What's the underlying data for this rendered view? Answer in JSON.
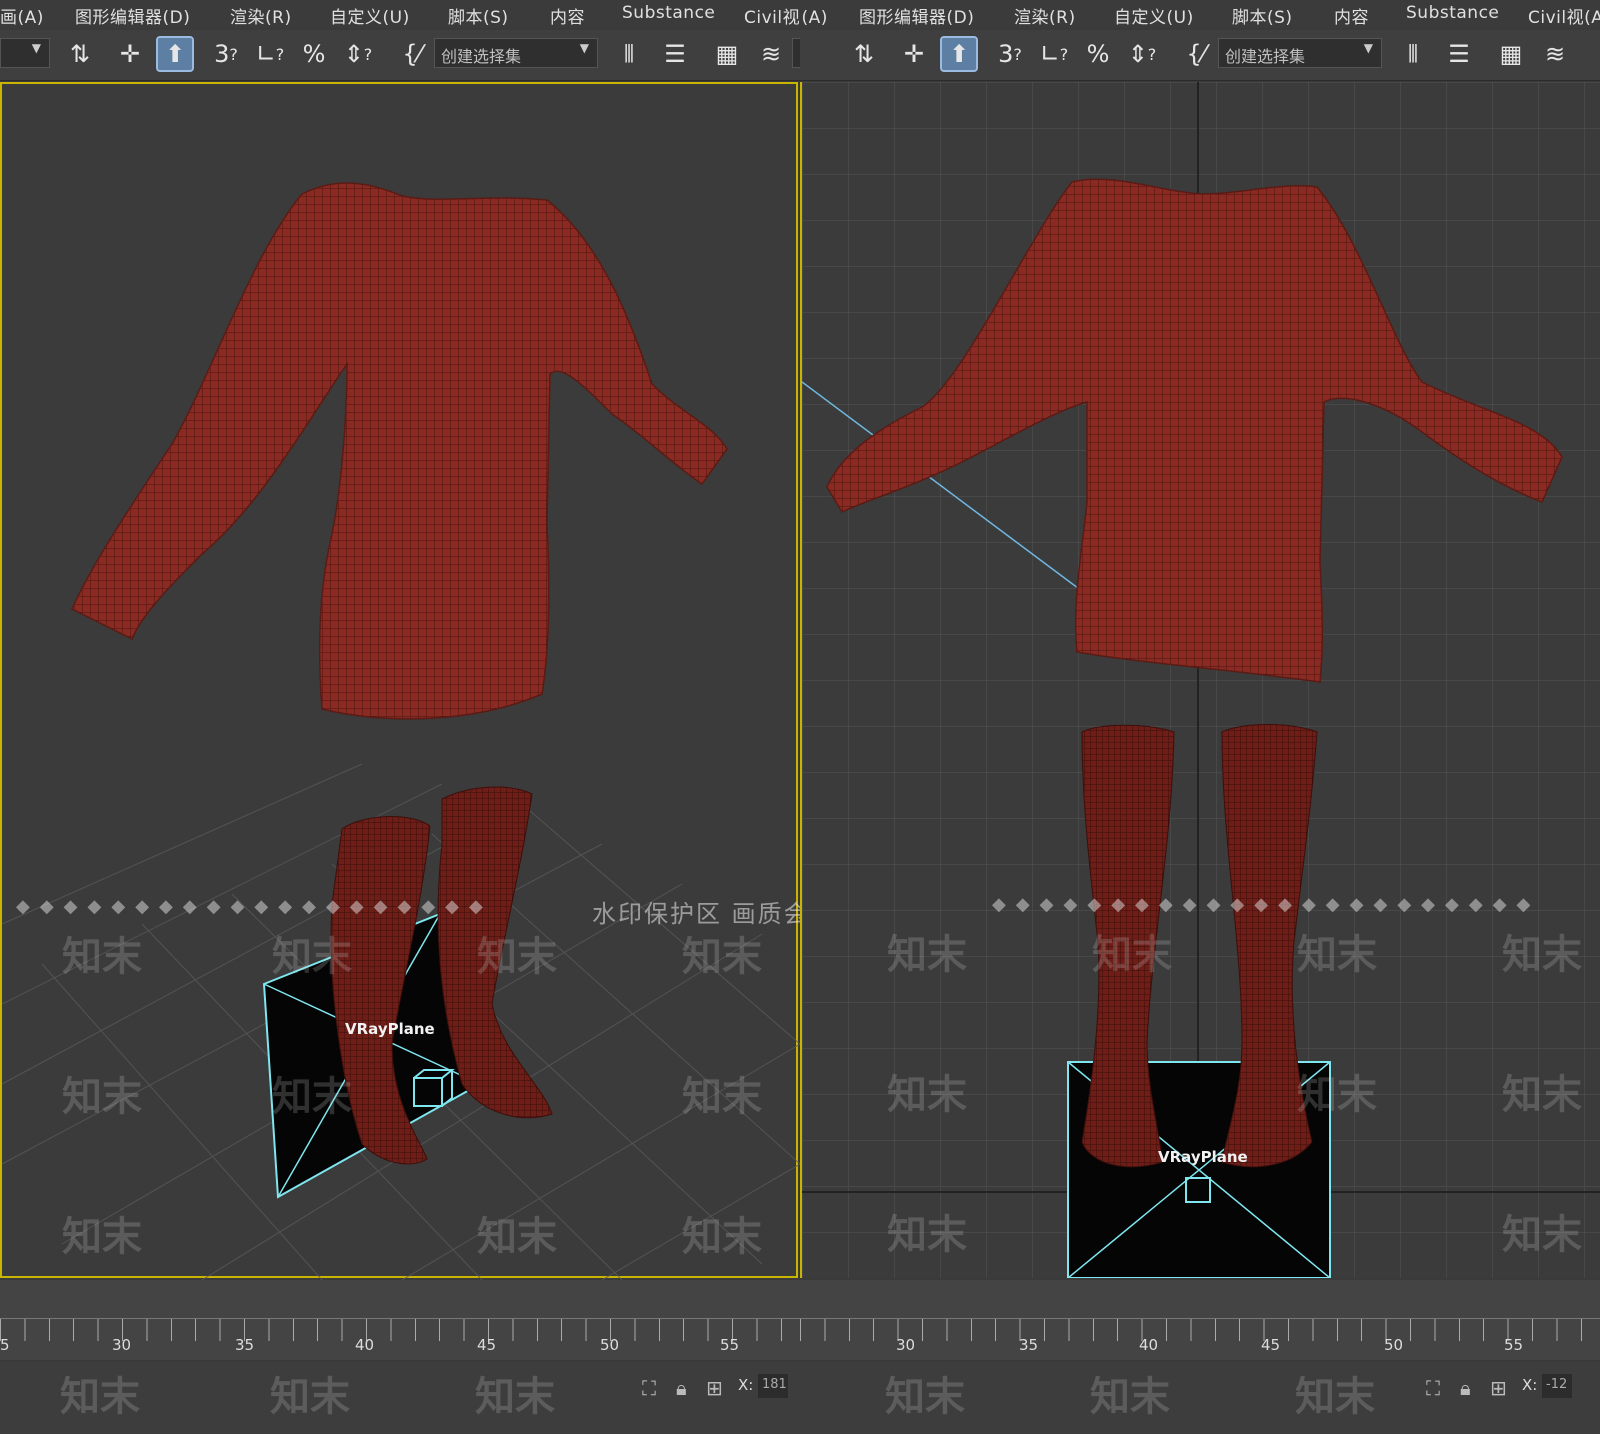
{
  "menu": [
    "画(A)",
    "图形编辑器(D)",
    "渲染(R)",
    "自定义(U)",
    "脚本(S)",
    "内容",
    "Substance",
    "Civil视(A)"
  ],
  "toolbar": {
    "selection_set_placeholder": "创建选择集",
    "snap_3": "3",
    "snap_angle": "2",
    "snap_percent": "%"
  },
  "viewport_left": {
    "object_label": "VRayPlane"
  },
  "viewport_right": {
    "object_label": "VRayPlane"
  },
  "watermark": {
    "banner": "水印保护区  画质会受到部分影响",
    "mark": "知末"
  },
  "timeline": {
    "ticks": [
      "5",
      "30",
      "35",
      "40",
      "45",
      "50",
      "55"
    ]
  },
  "status": {
    "x_label": "X:",
    "x_value_left": "181",
    "x_value_right": "-12"
  },
  "colors": {
    "viewport_border": "#c9b400",
    "garment": "#8a2a22",
    "selection": "#7fe6f0"
  }
}
